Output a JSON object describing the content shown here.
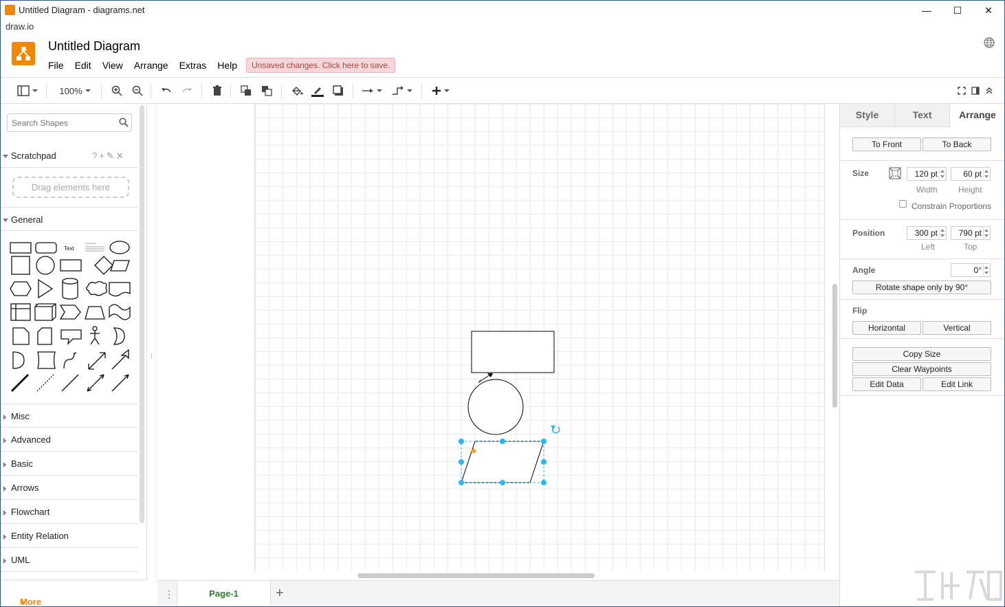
{
  "window": {
    "title": "Untitled Diagram - diagrams.net",
    "minimize": "—",
    "maximize": "☐",
    "close": "✕"
  },
  "app_label": "draw.io",
  "header": {
    "doc_title": "Untitled Diagram",
    "menus": [
      "File",
      "Edit",
      "View",
      "Arrange",
      "Extras",
      "Help"
    ],
    "unsaved": "Unsaved changes. Click here to save."
  },
  "toolbar": {
    "zoom": "100%"
  },
  "left_panel": {
    "search_placeholder": "Search Shapes",
    "scratchpad": {
      "label": "Scratchpad",
      "dropzone": "Drag elements here"
    },
    "general": "General",
    "shape_text_label": "Text",
    "sections": [
      "Misc",
      "Advanced",
      "Basic",
      "Arrows",
      "Flowchart",
      "Entity Relation",
      "UML"
    ],
    "more_shapes": "More Shapes..."
  },
  "bottom": {
    "page_tab": "Page-1"
  },
  "right_panel": {
    "tabs": [
      "Style",
      "Text",
      "Arrange"
    ],
    "to_front": "To Front",
    "to_back": "To Back",
    "size_label": "Size",
    "width_value": "120 pt",
    "height_value": "60 pt",
    "width_label": "Width",
    "height_label": "Height",
    "constrain": "Constrain Proportions",
    "position_label": "Position",
    "left_value": "300 pt",
    "top_value": "790 pt",
    "left_label": "Left",
    "top_label": "Top",
    "angle_label": "Angle",
    "angle_value": "0°",
    "rotate_btn": "Rotate shape only by 90°",
    "flip_label": "Flip",
    "horizontal": "Horizontal",
    "vertical": "Vertical",
    "copy_size": "Copy Size",
    "clear_waypoints": "Clear Waypoints",
    "edit_data": "Edit Data",
    "edit_link": "Edit Link"
  },
  "colors": {
    "accent": "#f08705",
    "selection": "#29b6f2",
    "page_tab": "#2e7d32",
    "unsaved_bg": "#f8d7da"
  }
}
